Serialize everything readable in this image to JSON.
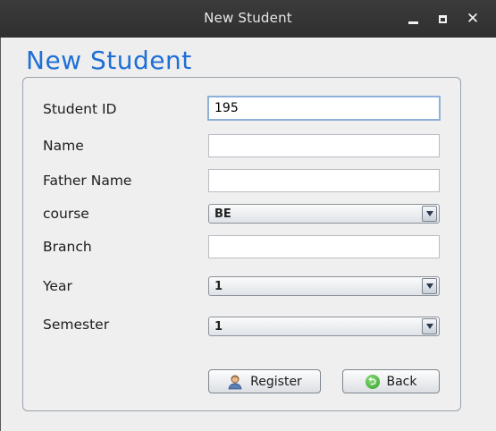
{
  "window": {
    "title": "New Student"
  },
  "heading": "New Student",
  "form": {
    "student_id": {
      "label": "Student ID",
      "value": "195"
    },
    "name": {
      "label": "Name",
      "value": ""
    },
    "father_name": {
      "label": "Father Name",
      "value": ""
    },
    "course": {
      "label": "course",
      "selected": "BE"
    },
    "branch": {
      "label": "Branch",
      "value": ""
    },
    "year": {
      "label": "Year",
      "selected": "1"
    },
    "semester": {
      "label": "Semester",
      "selected": "1"
    }
  },
  "buttons": {
    "register": "Register",
    "back": "Back"
  },
  "icons": {
    "minimize": "minimize-icon",
    "maximize": "maximize-icon",
    "close": "close-icon",
    "register": "user-icon",
    "back": "back-arrow-icon"
  },
  "colors": {
    "heading": "#1f6fd6",
    "titlebar": "#353535",
    "background": "#eeeeee"
  }
}
